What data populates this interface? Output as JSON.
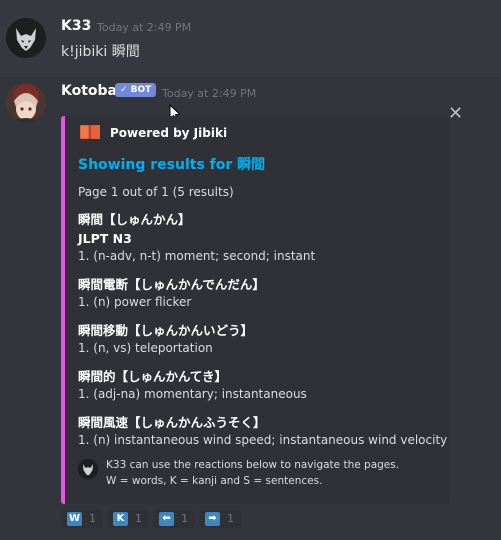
{
  "messages": [
    {
      "author": "K33",
      "timestamp": "Today at 2:49 PM",
      "content": "k!jibiki 瞬間"
    },
    {
      "author": "Kotoba",
      "badge": "✓ BOT",
      "timestamp": "Today at 2:49 PM"
    }
  ],
  "embed": {
    "accent_color": "#e755e7",
    "author": "Powered by Jibiki",
    "author_icon": "book-icon",
    "title": "Showing results for 瞬間",
    "page_info": "Page 1 out of 1 (5 results)",
    "results": [
      {
        "word": "瞬間【しゅんかん】",
        "tag": "JLPT N3",
        "definition": "1. (n-adv, n-t) moment; second; instant"
      },
      {
        "word": "瞬間電断【しゅんかんでんだん】",
        "definition": "1. (n) power flicker"
      },
      {
        "word": "瞬間移動【しゅんかんいどう】",
        "definition": "1. (n, vs) teleportation"
      },
      {
        "word": "瞬間的【しゅんかんてき】",
        "definition": "1. (adj-na) momentary; instantaneous"
      },
      {
        "word": "瞬間風速【しゅんかんふうそく】",
        "definition": "1. (n) instantaneous wind speed; instantaneous wind velocity"
      }
    ],
    "footer": [
      "K33 can use the reactions below to navigate the pages.",
      "W = words, K = kanji and S = sentences."
    ]
  },
  "reactions": [
    {
      "label": "W",
      "count": "1",
      "icon": "w-key-icon"
    },
    {
      "label": "K",
      "count": "1",
      "icon": "k-key-icon"
    },
    {
      "label": "⬅",
      "count": "1",
      "icon": "arrow-left-icon"
    },
    {
      "label": "➡",
      "count": "1",
      "icon": "arrow-right-icon"
    }
  ],
  "colors": {
    "title_link": "#00b0f4",
    "bot_badge": "#7289da",
    "reaction_key": "#3b88c3"
  }
}
